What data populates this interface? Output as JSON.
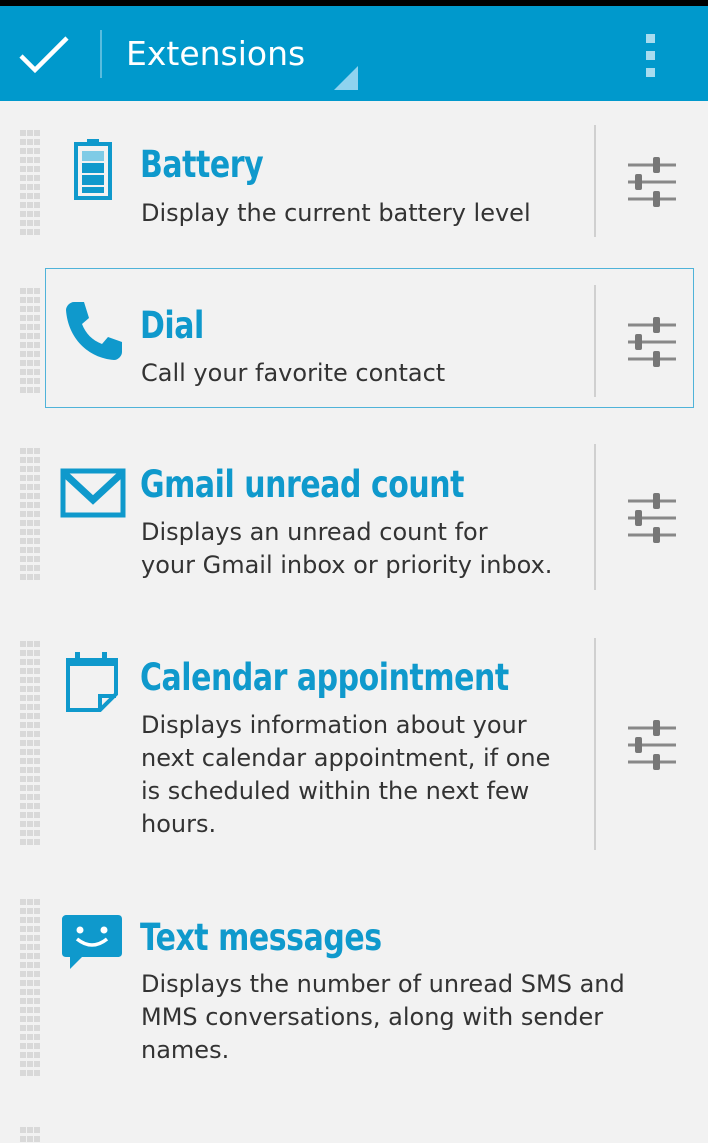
{
  "actionbar": {
    "title": "Extensions",
    "done_icon": "checkmark-icon",
    "overflow_icon": "overflow-menu-icon",
    "color": "#0099cc"
  },
  "accent_color": "#0f99cc",
  "extensions": [
    {
      "title": "Battery",
      "description": "Display the current battery level",
      "icon": "battery-icon",
      "has_settings": true,
      "selected": false
    },
    {
      "title": "Dial",
      "description": "Call your favorite contact",
      "icon": "phone-icon",
      "has_settings": true,
      "selected": true
    },
    {
      "title": "Gmail unread count",
      "description_lines": [
        "Displays an unread count for",
        "your Gmail inbox or priority inbox."
      ],
      "icon": "gmail-icon",
      "has_settings": true,
      "selected": false
    },
    {
      "title": "Calendar appointment",
      "description_lines": [
        "Displays information about your",
        "next calendar appointment, if one",
        "is scheduled within the next few",
        "hours."
      ],
      "icon": "calendar-icon",
      "has_settings": true,
      "selected": false
    },
    {
      "title": "Text messages",
      "description_lines": [
        "Displays the number of unread SMS and",
        "MMS conversations, along with sender",
        "names."
      ],
      "icon": "sms-icon",
      "has_settings": false,
      "selected": false
    }
  ]
}
